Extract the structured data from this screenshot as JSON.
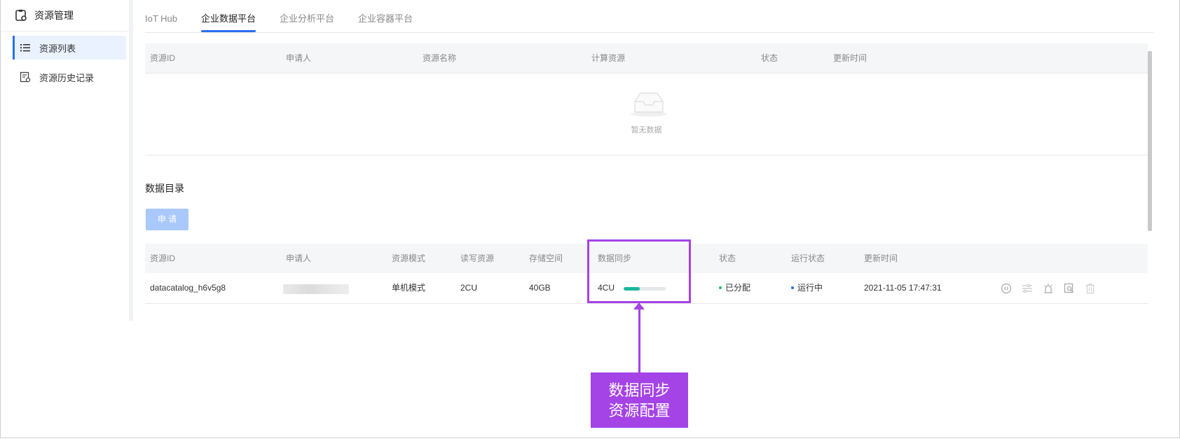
{
  "sidebar": {
    "title": "资源管理",
    "items": [
      {
        "label": "资源列表",
        "active": true
      },
      {
        "label": "资源历史记录",
        "active": false
      }
    ]
  },
  "tabs": [
    {
      "label": "IoT Hub",
      "active": false
    },
    {
      "label": "企业数据平台",
      "active": true
    },
    {
      "label": "企业分析平台",
      "active": false
    },
    {
      "label": "企业容器平台",
      "active": false
    }
  ],
  "table1": {
    "headers": [
      "资源ID",
      "申请人",
      "资源名称",
      "计算资源",
      "状态",
      "更新时间"
    ],
    "empty_text": "暂无数据"
  },
  "catalog": {
    "title": "数据目录",
    "apply_label": "申 请",
    "headers": [
      "资源ID",
      "申请人",
      "资源模式",
      "读写资源",
      "存储空间",
      "数据同步",
      "状态",
      "运行状态",
      "更新时间"
    ],
    "row": {
      "id": "datacatalog_h6v5g8",
      "mode": "单机模式",
      "rw": "2CU",
      "storage": "40GB",
      "sync": "4CU",
      "sync_progress": 0.38,
      "status": "已分配",
      "status_color": "#19be6b",
      "run_status": "运行中",
      "run_status_color": "#2b6ff0",
      "updated": "2021-11-05 17:47:31"
    },
    "action_icons": [
      "pause-icon",
      "settings-icon",
      "alarm-icon",
      "view-icon",
      "delete-icon"
    ]
  },
  "callout": {
    "line1": "数据同步",
    "line2": "资源配置",
    "color": "#a443e6"
  }
}
